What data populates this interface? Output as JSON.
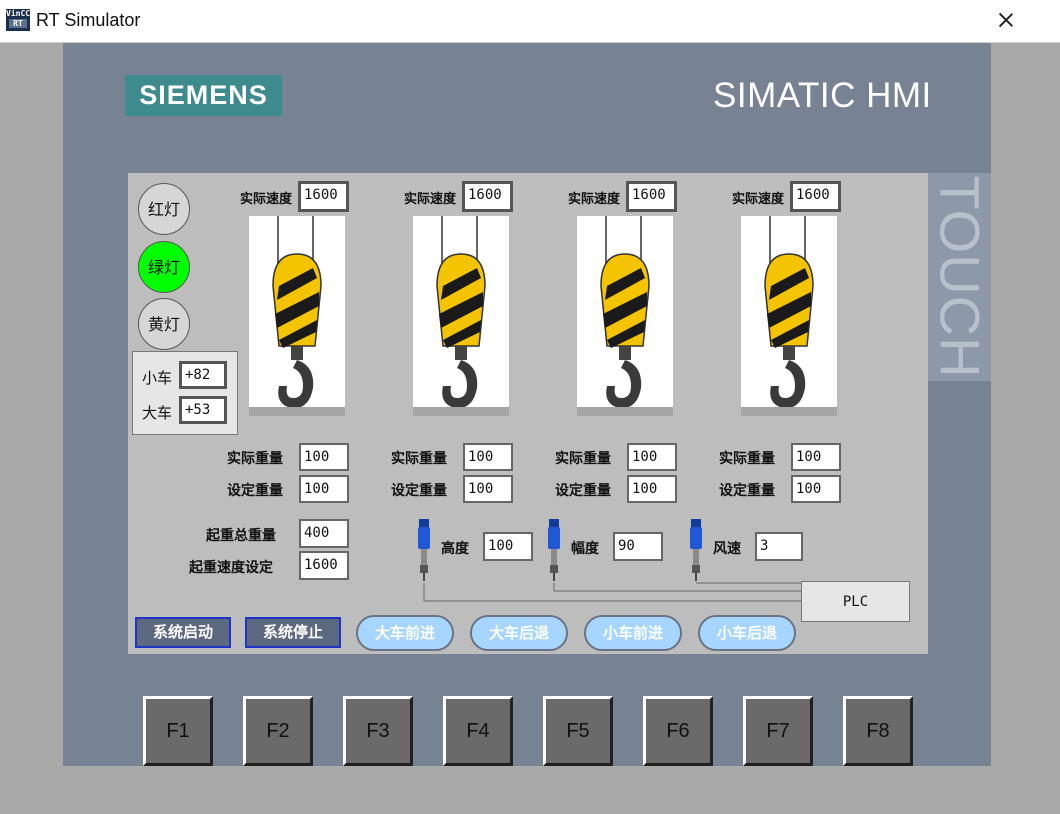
{
  "window": {
    "icon_text_top": "VinCC",
    "icon_text_bottom": "RT",
    "title": "RT Simulator"
  },
  "device": {
    "brand": "SIEMENS",
    "model": "SIMATIC HMI",
    "touch_label": "TOUCH"
  },
  "lamps": [
    {
      "label": "红灯",
      "lit": false,
      "color": "#d6d6d6"
    },
    {
      "label": "绿灯",
      "lit": true,
      "color": "#00ff00"
    },
    {
      "label": "黄灯",
      "lit": false,
      "color": "#d6d6d6"
    }
  ],
  "positions": {
    "trolley_label": "小车",
    "trolley_value": "+82",
    "bridge_label": "大车",
    "bridge_value": "+53"
  },
  "hoists": [
    {
      "speed_label": "实际速度",
      "speed": "1600",
      "weight_label": "实际重量",
      "weight": "100",
      "set_label": "设定重量",
      "set": "100"
    },
    {
      "speed_label": "实际速度",
      "speed": "1600",
      "weight_label": "实际重量",
      "weight": "100",
      "set_label": "设定重量",
      "set": "100"
    },
    {
      "speed_label": "实际速度",
      "speed": "1600",
      "weight_label": "实际重量",
      "weight": "100",
      "set_label": "设定重量",
      "set": "100"
    },
    {
      "speed_label": "实际速度",
      "speed": "1600",
      "weight_label": "实际重量",
      "weight": "100",
      "set_label": "设定重量",
      "set": "100"
    }
  ],
  "totals": {
    "total_weight_label": "起重总重量",
    "total_weight": "400",
    "speed_setting_label": "起重速度设定",
    "speed_setting": "1600"
  },
  "sensors": [
    {
      "label": "高度",
      "value": "100"
    },
    {
      "label": "幅度",
      "value": "90"
    },
    {
      "label": "风速",
      "value": "3"
    }
  ],
  "plc_label": "PLC",
  "controls": {
    "start": "系统启动",
    "stop": "系统停止",
    "bridge_forward": "大车前进",
    "bridge_back": "大车后退",
    "trolley_forward": "小车前进",
    "trolley_back": "小车后退"
  },
  "function_keys": [
    "F1",
    "F2",
    "F3",
    "F4",
    "F5",
    "F6",
    "F7",
    "F8"
  ],
  "colors": {
    "device_bezel": "#778293",
    "screen_bg": "#bdbdbd",
    "brand_logo": "#3e8b8d",
    "lamp_green": "#00ff00",
    "command_button": "#5d6980",
    "jog_button": "#a6d6ff",
    "hook_yellow": "#f5c400"
  }
}
